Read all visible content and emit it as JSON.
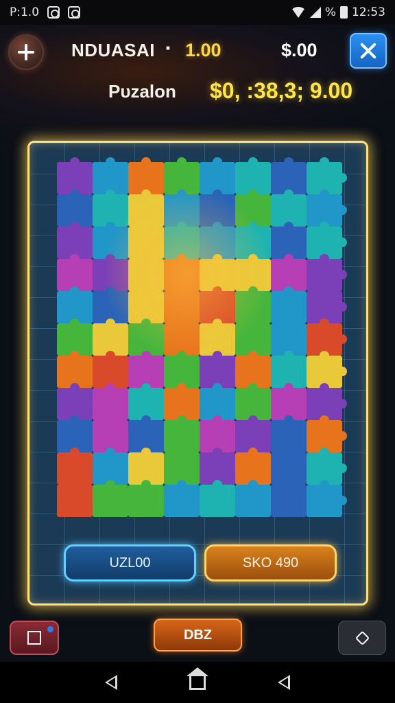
{
  "status_bar": {
    "time_left": "P:1.0",
    "time_right": "12:53",
    "battery_label": "%"
  },
  "header": {
    "title": "NDUASAI",
    "separator": "·",
    "value": "1.00",
    "money": "$.00",
    "sub_label": "Pυzalon",
    "sub_value": "$0, :38,3; 9.00"
  },
  "board": {
    "button_left": "UZL00",
    "button_right": "SKO 490",
    "palette": [
      "#7b3fb8",
      "#2196c9",
      "#e8731d",
      "#46b53c",
      "#1eb3b0",
      "#e9c93a",
      "#b73fb5",
      "#2a63b8",
      "#d94a2b"
    ],
    "grid": [
      [
        0,
        1,
        2,
        3,
        1,
        4,
        7,
        4
      ],
      [
        7,
        4,
        5,
        1,
        7,
        3,
        4,
        1
      ],
      [
        0,
        1,
        5,
        4,
        1,
        4,
        7,
        4
      ],
      [
        6,
        0,
        5,
        2,
        5,
        5,
        6,
        0
      ],
      [
        1,
        7,
        5,
        2,
        8,
        3,
        1,
        0
      ],
      [
        3,
        5,
        3,
        2,
        5,
        3,
        1,
        8
      ],
      [
        2,
        8,
        6,
        3,
        0,
        2,
        4,
        5
      ],
      [
        0,
        6,
        4,
        2,
        1,
        3,
        6,
        0
      ],
      [
        7,
        6,
        7,
        3,
        6,
        0,
        7,
        2
      ],
      [
        8,
        1,
        5,
        3,
        0,
        2,
        7,
        4
      ],
      [
        8,
        3,
        3,
        1,
        4,
        1,
        7,
        1
      ]
    ]
  },
  "bottom_bar": {
    "center_button": "DBZ"
  },
  "icons": {
    "top_left": "plus-icon",
    "top_right": "close-icon",
    "bottom_left": "square-icon",
    "bottom_right": "diamond-icon"
  }
}
